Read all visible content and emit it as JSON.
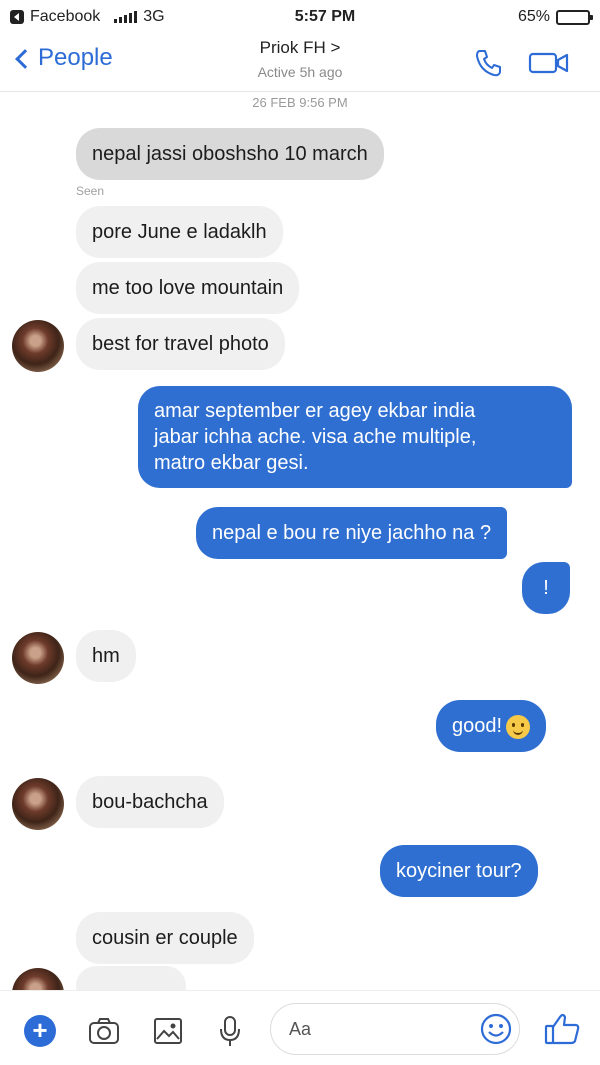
{
  "status_bar": {
    "carrier": "Facebook",
    "network": "3G",
    "time": "5:57 PM",
    "battery": "65%",
    "battery_level": 0.65
  },
  "header": {
    "back_label": "People",
    "contact_name": "Priok FH >",
    "contact_status": "Active 5h ago",
    "accent_color": "#2d6cd6"
  },
  "conversation": {
    "timestamp": "26 FEB 9:56 PM",
    "seen_label": "Seen",
    "messages": [
      {
        "from": "them",
        "text": "nepal jassi oboshsho 10 march"
      },
      {
        "from": "them",
        "text": "pore June e ladaklh"
      },
      {
        "from": "them",
        "text": "me too love mountain"
      },
      {
        "from": "them",
        "text": "best for travel photo"
      },
      {
        "from": "me",
        "lines": [
          "amar september er agey ekbar india",
          "jabar ichha ache. visa ache multiple,",
          "matro ekbar gesi."
        ]
      },
      {
        "from": "me",
        "text": "nepal e bou re niye jachho na ?"
      },
      {
        "from": "me",
        "text": "!"
      },
      {
        "from": "them",
        "text": "hm"
      },
      {
        "from": "me",
        "text": "good!"
      },
      {
        "from": "them",
        "text": "bou-bachcha"
      },
      {
        "from": "me",
        "text": "koyciner tour?"
      },
      {
        "from": "them",
        "text": "cousin er couple"
      }
    ],
    "colors": {
      "outgoing": "#2f6fd1",
      "incoming": "#f1f0f0"
    }
  },
  "composer": {
    "placeholder": "Aa",
    "icons": [
      "plus-icon",
      "camera-icon",
      "image-icon",
      "microphone-icon",
      "emoji-icon",
      "like-icon"
    ]
  }
}
